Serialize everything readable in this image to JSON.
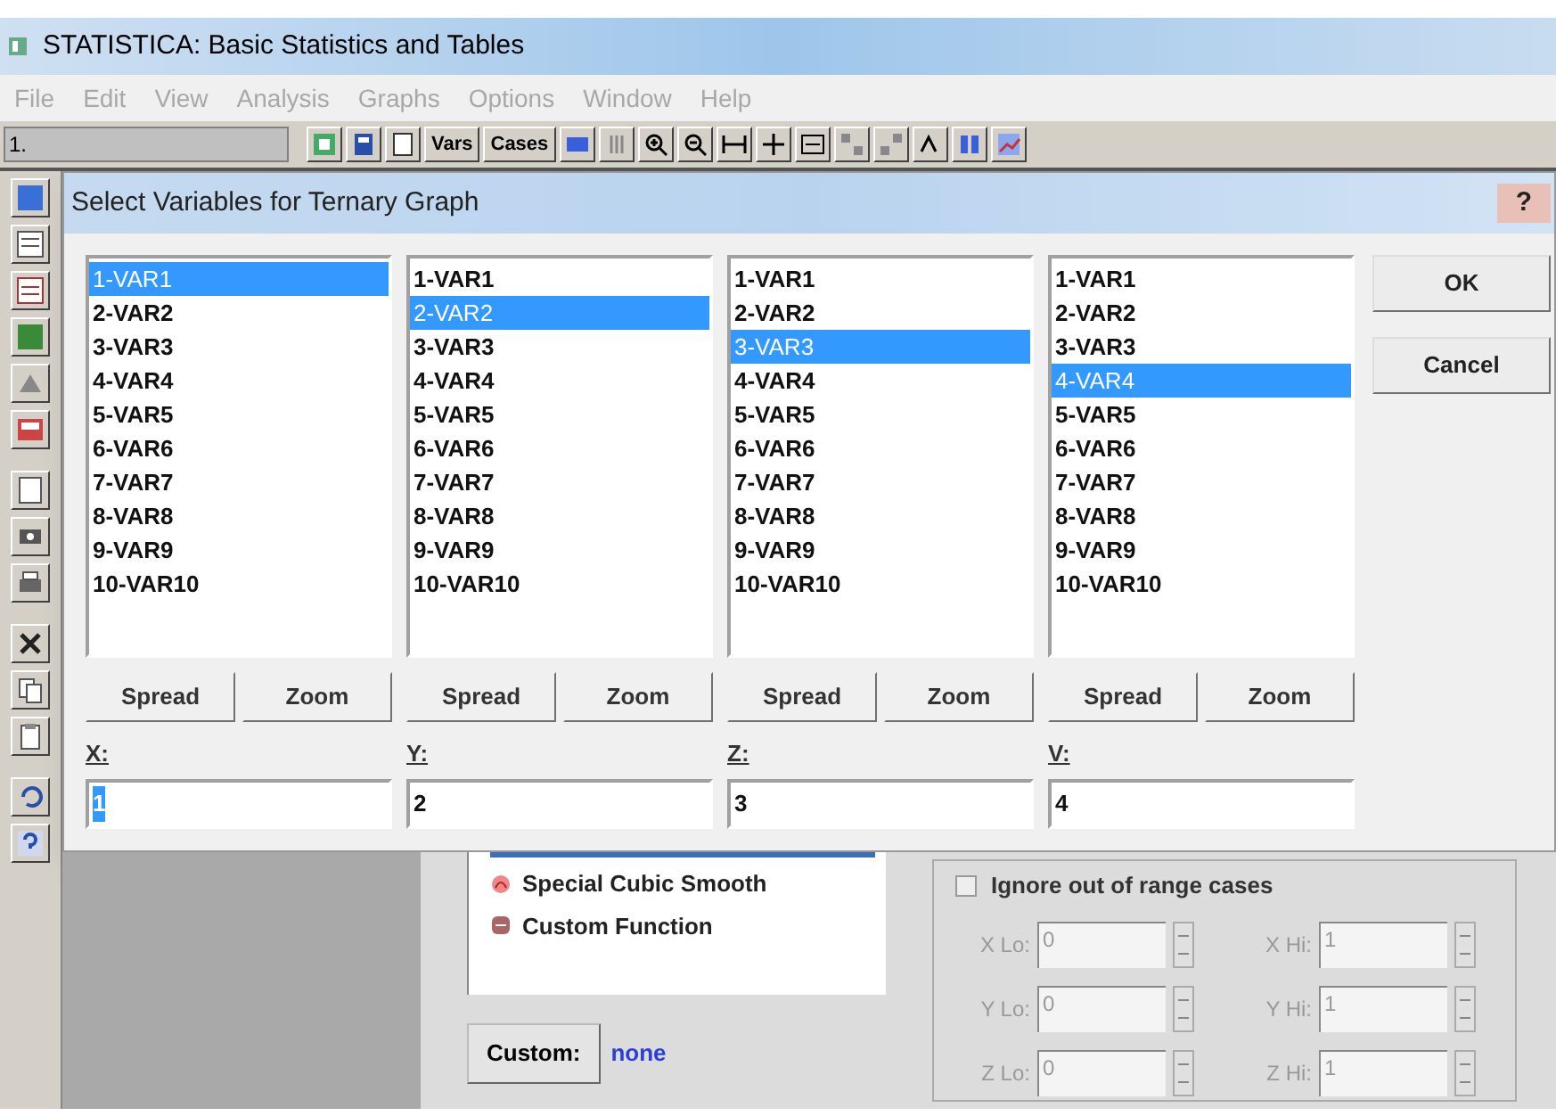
{
  "app_window": {
    "title": "STATISTICA: Basic Statistics and Tables"
  },
  "menu": [
    {
      "label": "File",
      "disabled": true
    },
    {
      "label": "Edit",
      "disabled": true
    },
    {
      "label": "View",
      "disabled": true
    },
    {
      "label": "Analysis",
      "disabled": true
    },
    {
      "label": "Graphs",
      "disabled": true
    },
    {
      "label": "Options",
      "disabled": true
    },
    {
      "label": "Window",
      "disabled": true
    },
    {
      "label": "Help",
      "disabled": true
    }
  ],
  "toolbar": {
    "field_value": "1.",
    "items": [
      {
        "kind": "icon"
      },
      {
        "kind": "icon"
      },
      {
        "kind": "icon"
      },
      {
        "kind": "text",
        "label": "Vars"
      },
      {
        "kind": "text",
        "label": "Cases"
      },
      {
        "kind": "icon"
      },
      {
        "kind": "icon"
      },
      {
        "kind": "icon"
      },
      {
        "kind": "icon"
      },
      {
        "kind": "icon"
      },
      {
        "kind": "icon"
      },
      {
        "kind": "icon"
      },
      {
        "kind": "icon"
      },
      {
        "kind": "icon"
      },
      {
        "kind": "icon"
      },
      {
        "kind": "icon"
      },
      {
        "kind": "icon"
      }
    ]
  },
  "dialog": {
    "title": "Select Variables for Ternary Graph",
    "help_glyph": "?",
    "columns": [
      {
        "items": [
          {
            "label": "1-VAR1",
            "selected": true
          },
          {
            "label": "2-VAR2",
            "selected": false
          },
          {
            "label": "3-VAR3",
            "selected": false
          },
          {
            "label": "4-VAR4",
            "selected": false
          },
          {
            "label": "5-VAR5",
            "selected": false
          },
          {
            "label": "6-VAR6",
            "selected": false
          },
          {
            "label": "7-VAR7",
            "selected": false
          },
          {
            "label": "8-VAR8",
            "selected": false
          },
          {
            "label": "9-VAR9",
            "selected": false
          },
          {
            "label": "10-VAR10",
            "selected": false
          }
        ],
        "buttons": [
          "Spread",
          "Zoom"
        ],
        "axis_label": "X:",
        "value": "1",
        "value_highlighted": true
      },
      {
        "items": [
          {
            "label": "1-VAR1",
            "selected": false
          },
          {
            "label": "2-VAR2",
            "selected": true
          },
          {
            "label": "3-VAR3",
            "selected": false
          },
          {
            "label": "4-VAR4",
            "selected": false
          },
          {
            "label": "5-VAR5",
            "selected": false
          },
          {
            "label": "6-VAR6",
            "selected": false
          },
          {
            "label": "7-VAR7",
            "selected": false
          },
          {
            "label": "8-VAR8",
            "selected": false
          },
          {
            "label": "9-VAR9",
            "selected": false
          },
          {
            "label": "10-VAR10",
            "selected": false
          }
        ],
        "buttons": [
          "Spread",
          "Zoom"
        ],
        "axis_label": "Y:",
        "value": "2",
        "value_highlighted": false
      },
      {
        "items": [
          {
            "label": "1-VAR1",
            "selected": false
          },
          {
            "label": "2-VAR2",
            "selected": false
          },
          {
            "label": "3-VAR3",
            "selected": true
          },
          {
            "label": "4-VAR4",
            "selected": false
          },
          {
            "label": "5-VAR5",
            "selected": false
          },
          {
            "label": "6-VAR6",
            "selected": false
          },
          {
            "label": "7-VAR7",
            "selected": false
          },
          {
            "label": "8-VAR8",
            "selected": false
          },
          {
            "label": "9-VAR9",
            "selected": false
          },
          {
            "label": "10-VAR10",
            "selected": false
          }
        ],
        "buttons": [
          "Spread",
          "Zoom"
        ],
        "axis_label": "Z:",
        "value": "3",
        "value_highlighted": false
      },
      {
        "items": [
          {
            "label": "1-VAR1",
            "selected": false
          },
          {
            "label": "2-VAR2",
            "selected": false
          },
          {
            "label": "3-VAR3",
            "selected": false
          },
          {
            "label": "4-VAR4",
            "selected": true
          },
          {
            "label": "5-VAR5",
            "selected": false
          },
          {
            "label": "6-VAR6",
            "selected": false
          },
          {
            "label": "7-VAR7",
            "selected": false
          },
          {
            "label": "8-VAR8",
            "selected": false
          },
          {
            "label": "9-VAR9",
            "selected": false
          },
          {
            "label": "10-VAR10",
            "selected": false
          }
        ],
        "buttons": [
          "Spread",
          "Zoom"
        ],
        "axis_label": "V:",
        "value": "4",
        "value_highlighted": false
      }
    ],
    "actions": [
      "OK",
      "Cancel"
    ]
  },
  "background_panel": {
    "fit_options": [
      {
        "label": "Special Cubic Smooth"
      },
      {
        "label": "Custom Function"
      }
    ],
    "custom_button": "Custom:",
    "custom_value": "none",
    "range": {
      "label": "Ignore out of range cases",
      "checked": false,
      "disabled": true,
      "fields": [
        {
          "label": "X Lo:",
          "value": "0"
        },
        {
          "label": "X Hi:",
          "value": "1"
        },
        {
          "label": "Y Lo:",
          "value": "0"
        },
        {
          "label": "Y Hi:",
          "value": "1"
        },
        {
          "label": "Z Lo:",
          "value": "0"
        },
        {
          "label": "Z Hi:",
          "value": "1"
        }
      ]
    }
  }
}
